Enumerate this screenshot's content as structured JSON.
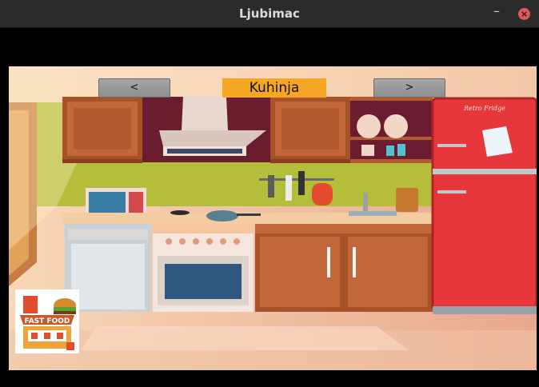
{
  "window": {
    "title": "Ljubimac"
  },
  "navigation": {
    "prev_label": "<",
    "next_label": ">",
    "room_name": "Kuhinja"
  },
  "fridge": {
    "brand": "Retro Fridge"
  },
  "fast_food": {
    "sign": "FAST FOOD"
  },
  "colors": {
    "room_label_bg": "#f5a623",
    "fridge": "#e8373a",
    "wall": "#a6b52a",
    "cabinet": "#b85a2e"
  }
}
